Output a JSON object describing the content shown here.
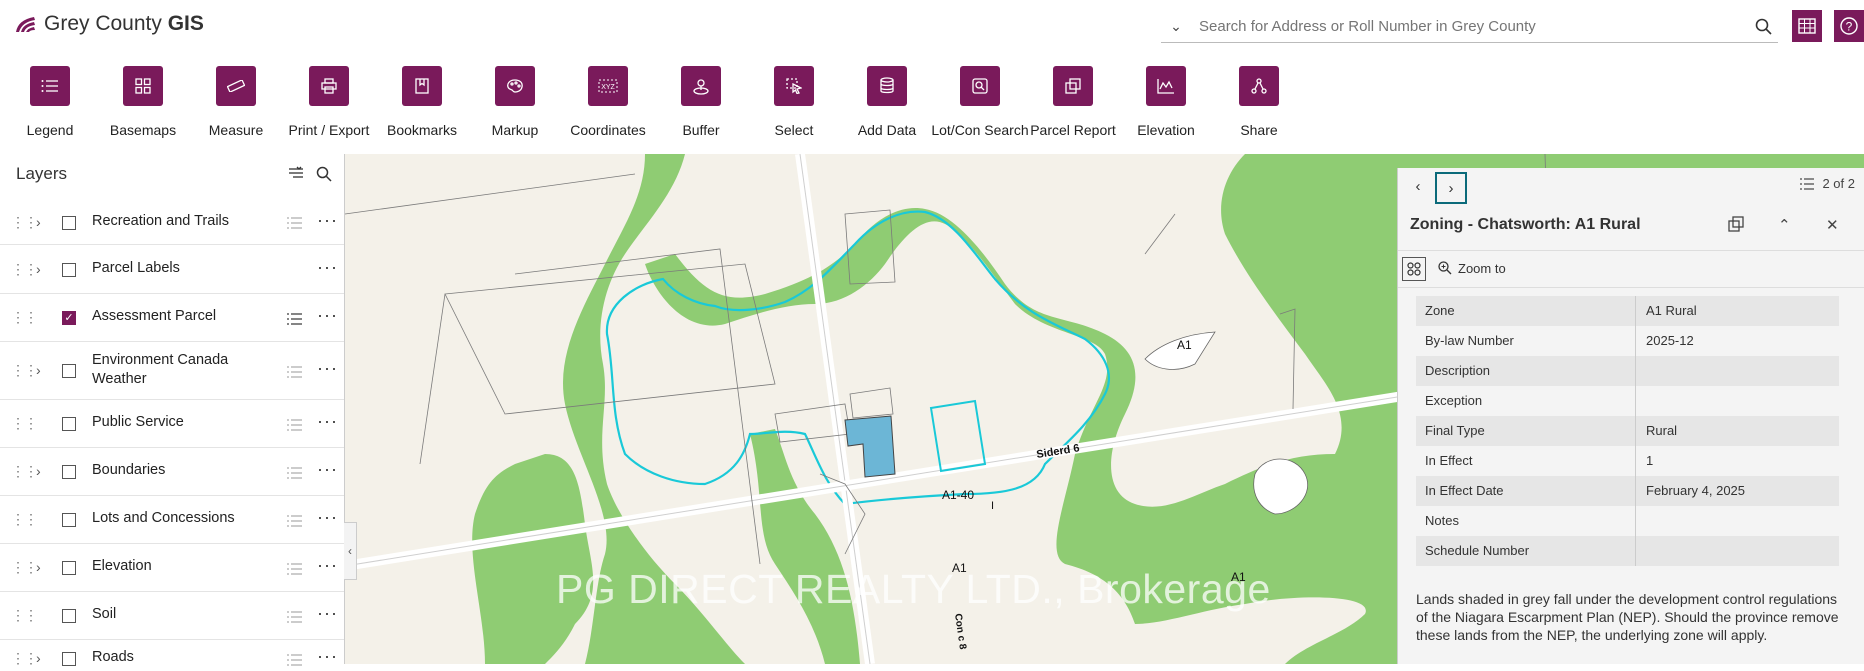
{
  "app": {
    "title_regular": "Grey County ",
    "title_bold": "GIS"
  },
  "search": {
    "placeholder": "Search for Address or Roll Number in Grey County"
  },
  "toolbar": [
    {
      "label": "Legend",
      "icon": "list-icon"
    },
    {
      "label": "Basemaps",
      "icon": "grid-icon"
    },
    {
      "label": "Measure",
      "icon": "ruler-icon"
    },
    {
      "label": "Print / Export",
      "icon": "printer-icon"
    },
    {
      "label": "Bookmarks",
      "icon": "bookmark-icon"
    },
    {
      "label": "Markup",
      "icon": "palette-icon"
    },
    {
      "label": "Coordinates",
      "icon": "xyz-icon"
    },
    {
      "label": "Buffer",
      "icon": "buffer-icon"
    },
    {
      "label": "Select",
      "icon": "select-icon"
    },
    {
      "label": "Add Data",
      "icon": "database-icon"
    },
    {
      "label": "Lot/Con Search",
      "icon": "search-map-icon"
    },
    {
      "label": "Parcel Report",
      "icon": "copy-icon"
    },
    {
      "label": "Elevation",
      "icon": "elevation-icon"
    },
    {
      "label": "Share",
      "icon": "share-icon"
    }
  ],
  "layers": {
    "title": "Layers",
    "items": [
      {
        "label": "Recreation and Trails",
        "expandable": true,
        "checked": false
      },
      {
        "label": "Parcel Labels",
        "expandable": true,
        "checked": false
      },
      {
        "label": "Assessment Parcel",
        "expandable": false,
        "checked": true
      },
      {
        "label": "Environment Canada Weather",
        "expandable": true,
        "checked": false
      },
      {
        "label": "Public Service",
        "expandable": false,
        "checked": false
      },
      {
        "label": "Boundaries",
        "expandable": true,
        "checked": false
      },
      {
        "label": "Lots and Concessions",
        "expandable": false,
        "checked": false
      },
      {
        "label": "Elevation",
        "expandable": true,
        "checked": false
      },
      {
        "label": "Soil",
        "expandable": false,
        "checked": false
      },
      {
        "label": "Roads",
        "expandable": true,
        "checked": false
      }
    ]
  },
  "map": {
    "labels": {
      "a1_top_right": "A1",
      "siderd": "Siderd 6",
      "a1_40": "A1-40",
      "i": "I",
      "a1_center": "A1",
      "a1_bottom_right": "A1",
      "conc": "Con c 8"
    },
    "watermark": "PG DIRECT REALTY LTD., Brokerage"
  },
  "popup": {
    "count": "2 of 2",
    "title": "Zoning - Chatsworth: A1 Rural",
    "zoom_label": "Zoom to",
    "fields": [
      {
        "key": "Zone",
        "value": "A1 Rural"
      },
      {
        "key": "By-law Number",
        "value": "2025-12"
      },
      {
        "key": "Description",
        "value": ""
      },
      {
        "key": "Exception",
        "value": ""
      },
      {
        "key": "Final Type",
        "value": "Rural"
      },
      {
        "key": "In Effect",
        "value": "1"
      },
      {
        "key": "In Effect Date",
        "value": "February 4, 2025"
      },
      {
        "key": "Notes",
        "value": ""
      },
      {
        "key": "Schedule Number",
        "value": ""
      }
    ],
    "note": "Lands shaded in grey fall under the development control regulations of the Niagara Escarpment Plan (NEP). Should the province remove these lands from the NEP, the underlying zone will apply."
  },
  "colors": {
    "brand": "#7a1a5b",
    "green": "#8fcc73",
    "parcel": "#6cb6d6",
    "outline": "#19c9d8"
  }
}
